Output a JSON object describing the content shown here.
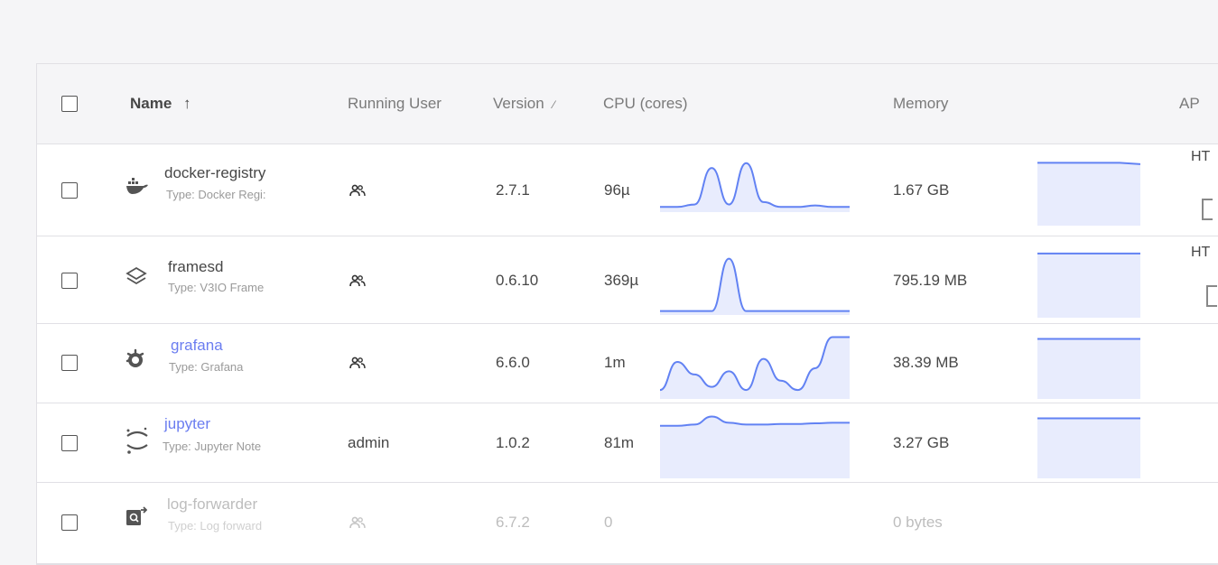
{
  "table": {
    "columns": {
      "name": "Name",
      "running_user": "Running User",
      "version": "Version",
      "cpu": "CPU (cores)",
      "memory": "Memory",
      "api": "AP"
    },
    "rows": [
      {
        "name": "docker-registry",
        "type": "Type: Docker Regi:",
        "user_icon": "users-icon",
        "version": "2.7.1",
        "cpu": "96µ",
        "memory": "1.67 GB",
        "api": "HT",
        "cpu_series": [
          0.05,
          0.05,
          0.1,
          0.85,
          0.1,
          0.95,
          0.15,
          0.05,
          0.05,
          0.08,
          0.05,
          0.05
        ],
        "mem_series": [
          0.9,
          0.9,
          0.9,
          0.9,
          0.9,
          0.88
        ]
      },
      {
        "name": "framesd",
        "type": "Type: V3IO Frame",
        "user_icon": "users-icon",
        "version": "0.6.10",
        "cpu": "369µ",
        "memory": "795.19 MB",
        "api": "HT",
        "cpu_series": [
          0.02,
          0.02,
          0.02,
          0.02,
          0.9,
          0.02,
          0.02,
          0.02,
          0.02,
          0.02,
          0.02,
          0.02
        ],
        "mem_series": [
          0.92,
          0.92,
          0.92,
          0.92,
          0.92,
          0.92
        ]
      },
      {
        "name": "grafana",
        "type": "Type: Grafana",
        "user_icon": "users-icon",
        "version": "6.6.0",
        "cpu": "1m",
        "memory": "38.39 MB",
        "api": "",
        "cpu_series": [
          0.1,
          0.55,
          0.35,
          0.15,
          0.4,
          0.1,
          0.6,
          0.25,
          0.1,
          0.45,
          0.95,
          0.95
        ],
        "mem_series": [
          0.92,
          0.92,
          0.92,
          0.92,
          0.92,
          0.92
        ]
      },
      {
        "name": "jupyter",
        "type": "Type: Jupyter Note",
        "user": "admin",
        "version": "1.0.2",
        "cpu": "81m",
        "memory": "3.27 GB",
        "api": "",
        "cpu_series": [
          0.8,
          0.8,
          0.82,
          0.95,
          0.85,
          0.82,
          0.82,
          0.83,
          0.83,
          0.84,
          0.85,
          0.85
        ],
        "mem_series": [
          0.92,
          0.92,
          0.92,
          0.92,
          0.92,
          0.92
        ]
      },
      {
        "name": "log-forwarder",
        "type": "Type: Log forward",
        "user_icon": "users-icon",
        "version": "6.7.2",
        "cpu": "0",
        "memory": "0 bytes",
        "api": ""
      }
    ]
  },
  "colors": {
    "accent": "#6b7df0",
    "chart_line": "#6282f3",
    "chart_fill": "#e8ecfd"
  }
}
